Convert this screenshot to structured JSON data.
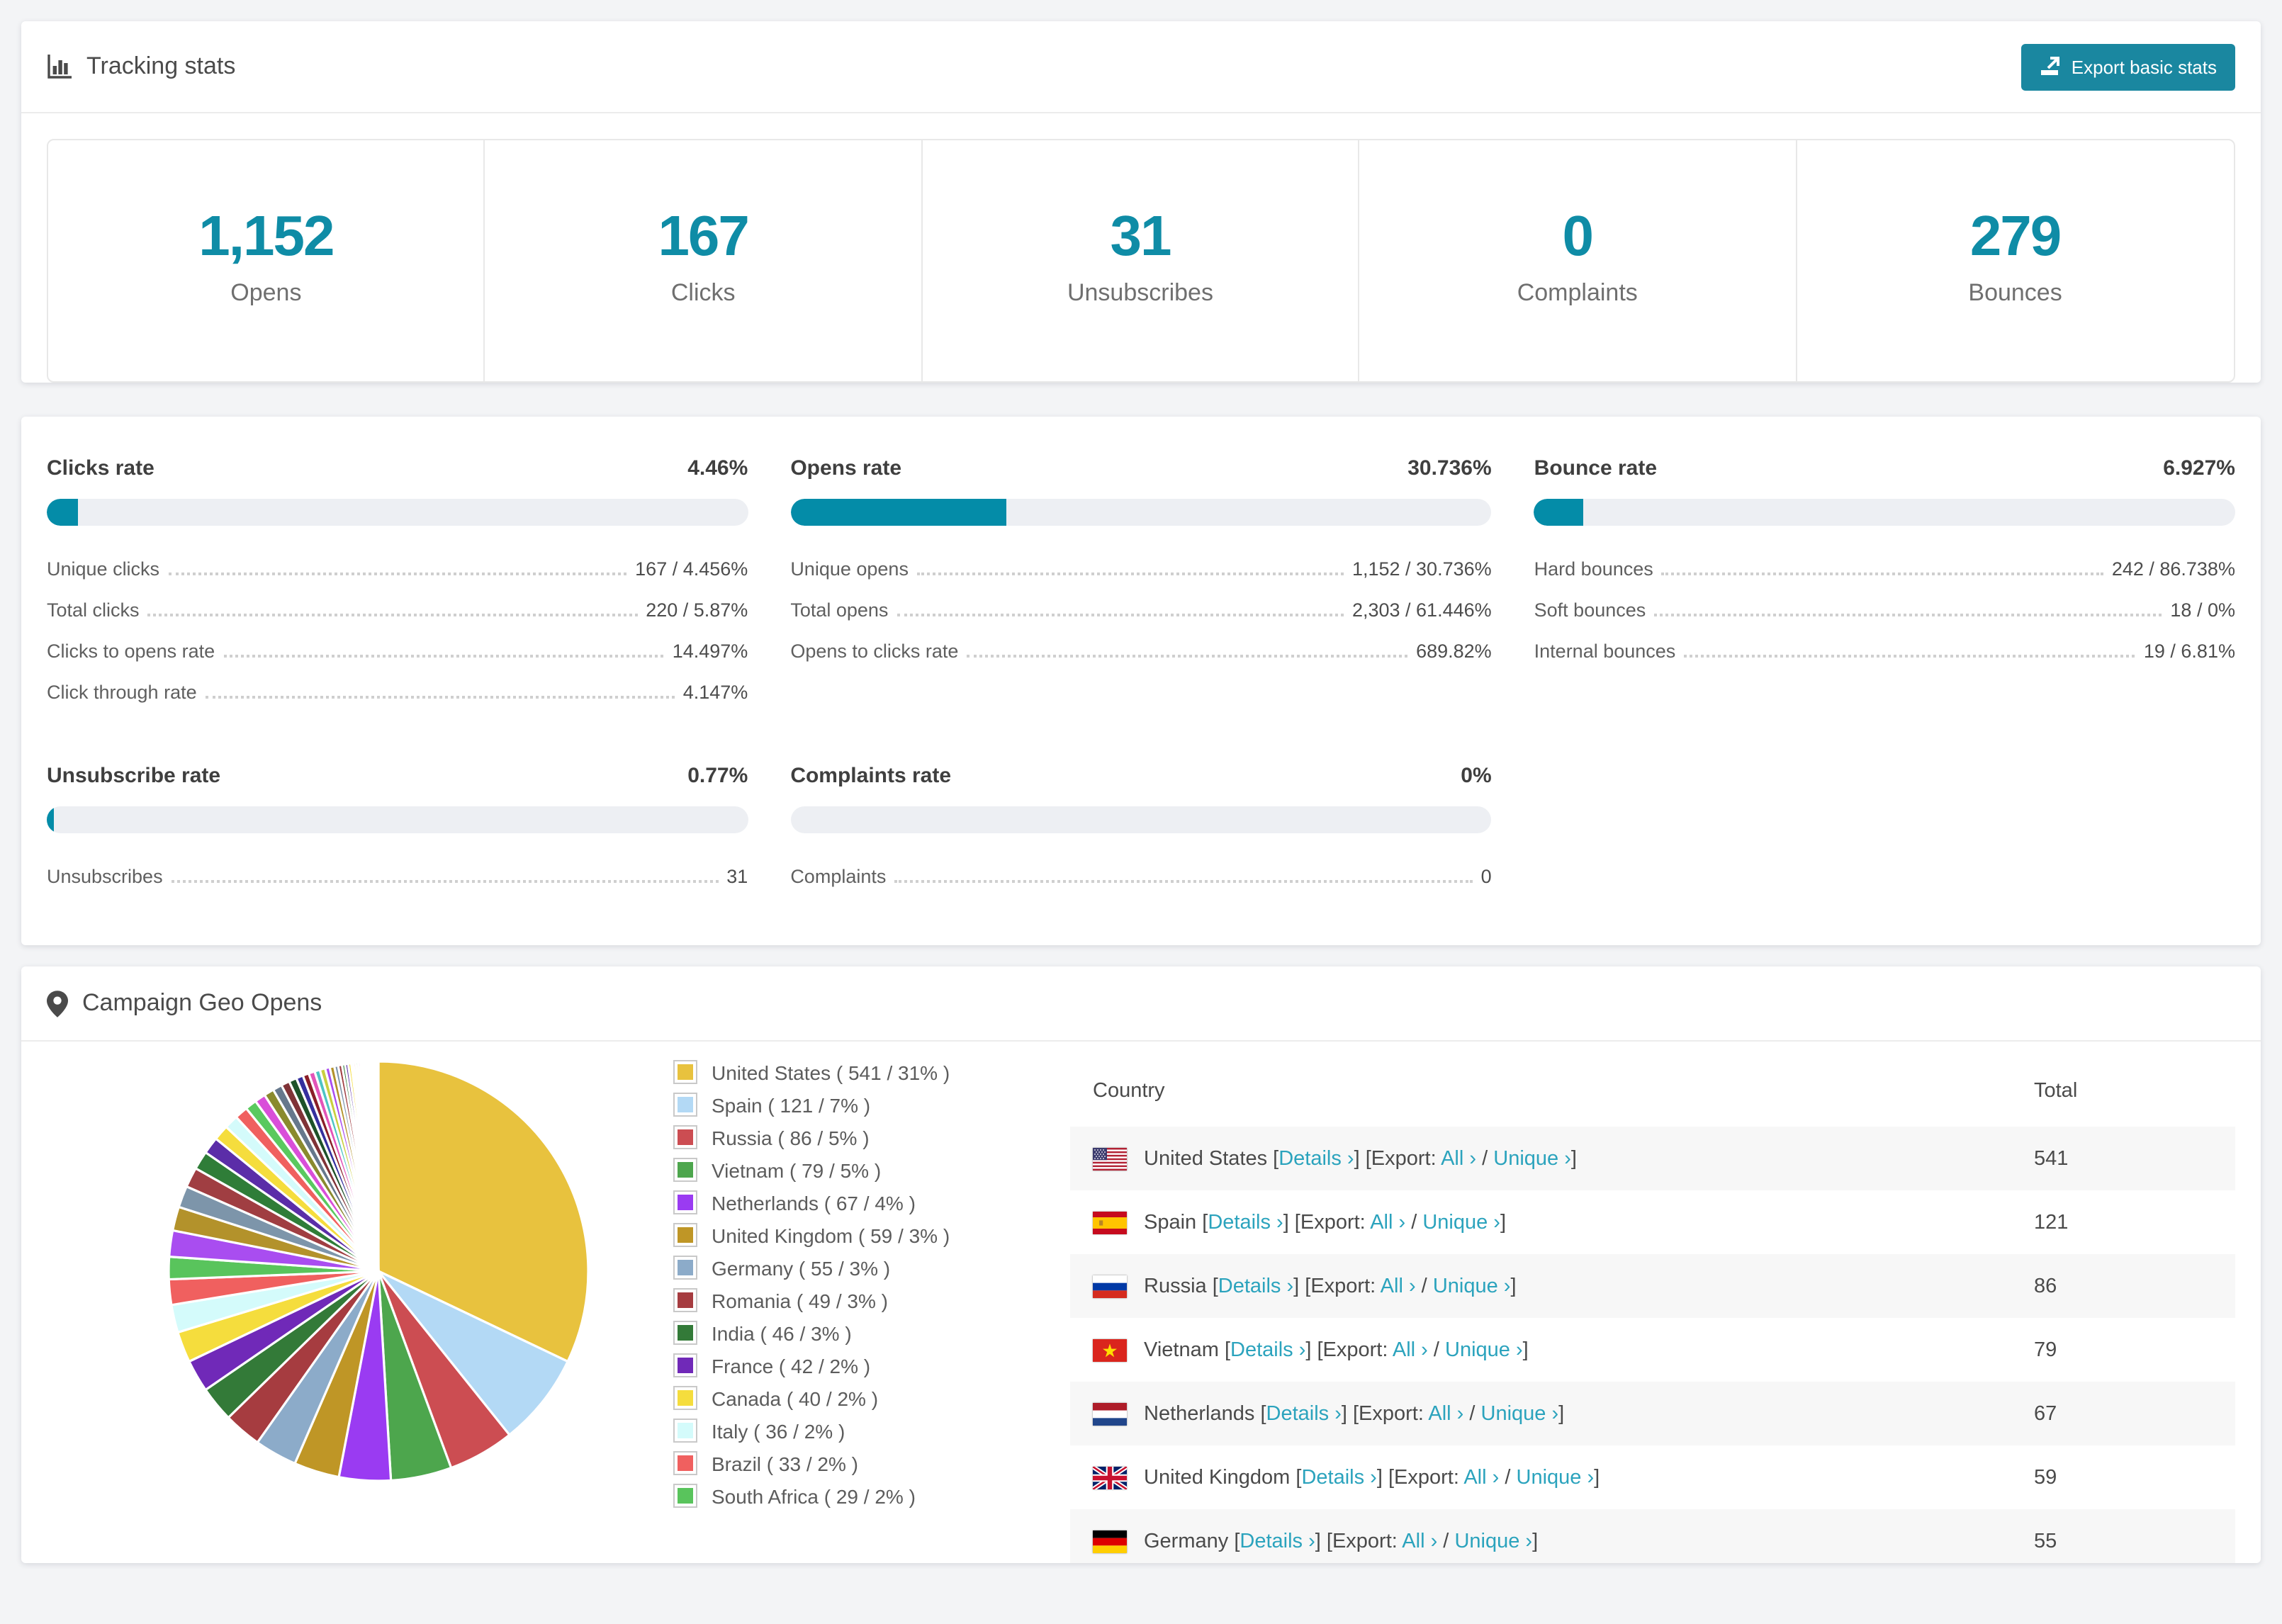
{
  "colors": {
    "accent": "#0f8ca6",
    "link": "#2ba3bd",
    "bar_track": "#edeff3"
  },
  "tracking": {
    "title": "Tracking stats",
    "export_label": "Export basic stats",
    "stats": [
      {
        "value": "1,152",
        "label": "Opens"
      },
      {
        "value": "167",
        "label": "Clicks"
      },
      {
        "value": "31",
        "label": "Unsubscribes"
      },
      {
        "value": "0",
        "label": "Complaints"
      },
      {
        "value": "279",
        "label": "Bounces"
      }
    ]
  },
  "rates": [
    {
      "title": "Clicks rate",
      "value": "4.46%",
      "percent": 4.46,
      "rows": [
        [
          "Unique clicks",
          "167 / 4.456%"
        ],
        [
          "Total clicks",
          "220 / 5.87%"
        ],
        [
          "Clicks to opens rate",
          "14.497%"
        ],
        [
          "Click through rate",
          "4.147%"
        ]
      ]
    },
    {
      "title": "Opens rate",
      "value": "30.736%",
      "percent": 30.736,
      "rows": [
        [
          "Unique opens",
          "1,152 / 30.736%"
        ],
        [
          "Total opens",
          "2,303 / 61.446%"
        ],
        [
          "Opens to clicks rate",
          "689.82%"
        ]
      ]
    },
    {
      "title": "Bounce rate",
      "value": "6.927%",
      "percent": 6.927,
      "rows": [
        [
          "Hard bounces",
          "242 / 86.738%"
        ],
        [
          "Soft bounces",
          "18 / 0%"
        ],
        [
          "Internal bounces",
          "19 / 6.81%"
        ]
      ]
    },
    {
      "title": "Unsubscribe rate",
      "value": "0.77%",
      "percent": 0.77,
      "rows": [
        [
          "Unsubscribes",
          "31"
        ]
      ]
    },
    {
      "title": "Complaints rate",
      "value": "0%",
      "percent": 0,
      "rows": [
        [
          "Complaints",
          "0"
        ]
      ]
    }
  ],
  "geo": {
    "title": "Campaign Geo Opens",
    "headers": {
      "country": "Country",
      "total": "Total"
    },
    "link_labels": {
      "details": "Details ›",
      "export_prefix": "Export:",
      "all": "All ›",
      "unique": "Unique ›"
    },
    "legend_format": "{name} ( {total} / {percent}% )",
    "visible_table_rows": 7,
    "countries": [
      {
        "name": "United States",
        "total": "541",
        "percent": "31",
        "color": "#e8c23e",
        "flag": "us"
      },
      {
        "name": "Spain",
        "total": "121",
        "percent": "7",
        "color": "#b3d9f5",
        "flag": "es"
      },
      {
        "name": "Russia",
        "total": "86",
        "percent": "5",
        "color": "#cc4d52",
        "flag": "ru"
      },
      {
        "name": "Vietnam",
        "total": "79",
        "percent": "5",
        "color": "#4da64d",
        "flag": "vn"
      },
      {
        "name": "Netherlands",
        "total": "67",
        "percent": "4",
        "color": "#9a3bf2",
        "flag": "nl"
      },
      {
        "name": "United Kingdom",
        "total": "59",
        "percent": "3",
        "color": "#bf9626",
        "flag": "gb"
      },
      {
        "name": "Germany",
        "total": "55",
        "percent": "3",
        "color": "#8cabc9",
        "flag": "de"
      },
      {
        "name": "Romania",
        "total": "49",
        "percent": "3",
        "color": "#a63c40",
        "flag": "ro"
      },
      {
        "name": "India",
        "total": "46",
        "percent": "3",
        "color": "#337a38",
        "flag": "in"
      },
      {
        "name": "France",
        "total": "42",
        "percent": "2",
        "color": "#7029b8",
        "flag": "fr"
      },
      {
        "name": "Canada",
        "total": "40",
        "percent": "2",
        "color": "#f5dd3d",
        "flag": "ca"
      },
      {
        "name": "Italy",
        "total": "36",
        "percent": "2",
        "color": "#d4fbfb",
        "flag": "it"
      },
      {
        "name": "Brazil",
        "total": "33",
        "percent": "2",
        "color": "#f0605f",
        "flag": "br"
      },
      {
        "name": "South Africa",
        "total": "29",
        "percent": "2",
        "color": "#59c45c",
        "flag": "za"
      }
    ]
  },
  "chart_data": {
    "type": "pie",
    "title": "Campaign Geo Opens",
    "legend_position": "right",
    "labels": [
      "United States",
      "Spain",
      "Russia",
      "Vietnam",
      "Netherlands",
      "United Kingdom",
      "Germany",
      "Romania",
      "India",
      "France",
      "Canada",
      "Italy",
      "Brazil",
      "South Africa"
    ],
    "values": [
      541,
      121,
      86,
      79,
      67,
      59,
      55,
      49,
      46,
      42,
      40,
      36,
      33,
      29
    ],
    "percents": [
      31,
      7,
      5,
      5,
      4,
      3,
      3,
      3,
      3,
      2,
      2,
      2,
      2,
      2
    ],
    "colors": [
      "#e8c23e",
      "#b3d9f5",
      "#cc4d52",
      "#4da64d",
      "#9a3bf2",
      "#bf9626",
      "#8cabc9",
      "#a63c40",
      "#337a38",
      "#7029b8",
      "#f5dd3d",
      "#d4fbfb",
      "#f0605f",
      "#59c45c"
    ],
    "other_slices": {
      "note": "unlabeled small countries fanning clockwise",
      "values": [
        34,
        31,
        28,
        26,
        24,
        22,
        20,
        18,
        17,
        15,
        14,
        13,
        12,
        11,
        10,
        9,
        8,
        8,
        7,
        7,
        6,
        6,
        5,
        5,
        4,
        4,
        4,
        3,
        3,
        3,
        3,
        2,
        2,
        2,
        2,
        2,
        1,
        1,
        1,
        1,
        1,
        1,
        1,
        1,
        1,
        1,
        1,
        1,
        1
      ],
      "colors": [
        "#a94df0",
        "#b3922b",
        "#7d95aa",
        "#a03e42",
        "#2f7d38",
        "#5b2da8",
        "#f5dd3d",
        "#d4fbfb",
        "#f0605f",
        "#5ac95f",
        "#d94fd9",
        "#8a8a2e",
        "#66788c",
        "#803337",
        "#1e5229",
        "#35309e",
        "#8a1e28",
        "#e354b8",
        "#4dc4c4",
        "#c9cf3f"
      ]
    }
  }
}
